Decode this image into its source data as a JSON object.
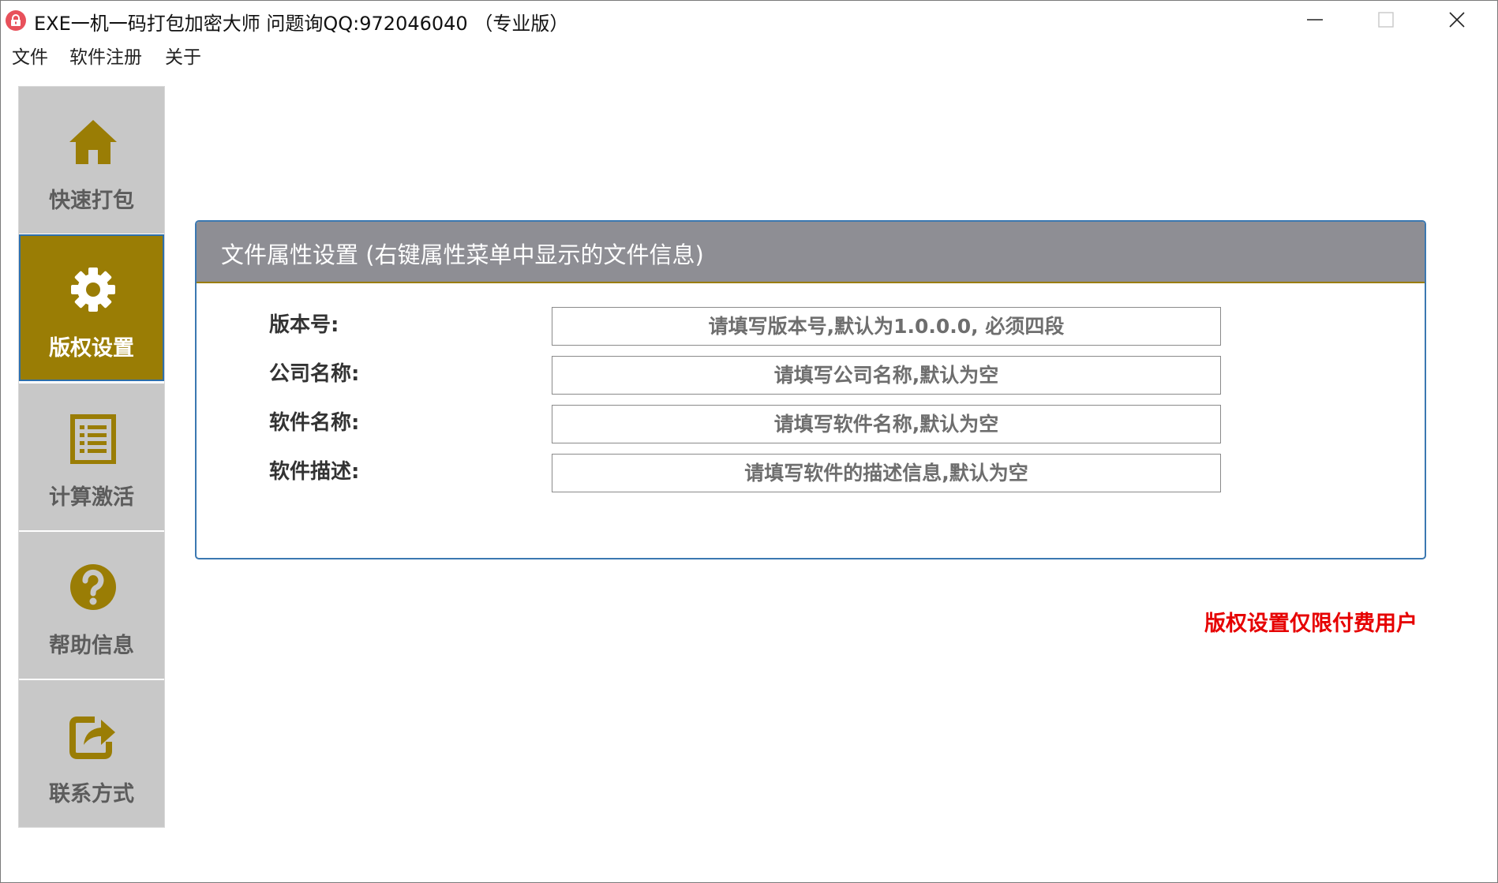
{
  "window": {
    "title": "EXE一机一码打包加密大师 问题询QQ:972046040 （专业版）"
  },
  "menu": [
    "文件",
    "软件注册",
    "关于"
  ],
  "sidebar": {
    "items": [
      {
        "label": "快速打包",
        "icon": "home-icon"
      },
      {
        "label": "版权设置",
        "icon": "gear-icon",
        "active": true
      },
      {
        "label": "计算激活",
        "icon": "list-document-icon"
      },
      {
        "label": "帮助信息",
        "icon": "question-icon"
      },
      {
        "label": "联系方式",
        "icon": "share-icon"
      }
    ]
  },
  "panel": {
    "title": "文件属性设置 (右键属性菜单中显示的文件信息)",
    "fields": [
      {
        "label": "版本号:",
        "value": "",
        "placeholder": "请填写版本号,默认为1.0.0.0, 必须四段"
      },
      {
        "label": "公司名称:",
        "value": "",
        "placeholder": "请填写公司名称,默认为空"
      },
      {
        "label": "软件名称:",
        "value": "",
        "placeholder": "请填写软件名称,默认为空"
      },
      {
        "label": "软件描述:",
        "value": "",
        "placeholder": "请填写软件的描述信息,默认为空"
      }
    ]
  },
  "notice": "版权设置仅限付费用户",
  "colors": {
    "accent": "#9a7d05",
    "nav_bg": "#c8c8c8",
    "header_bg": "#8e8e94",
    "panel_border": "#3b78b1",
    "notice": "#e60000"
  }
}
